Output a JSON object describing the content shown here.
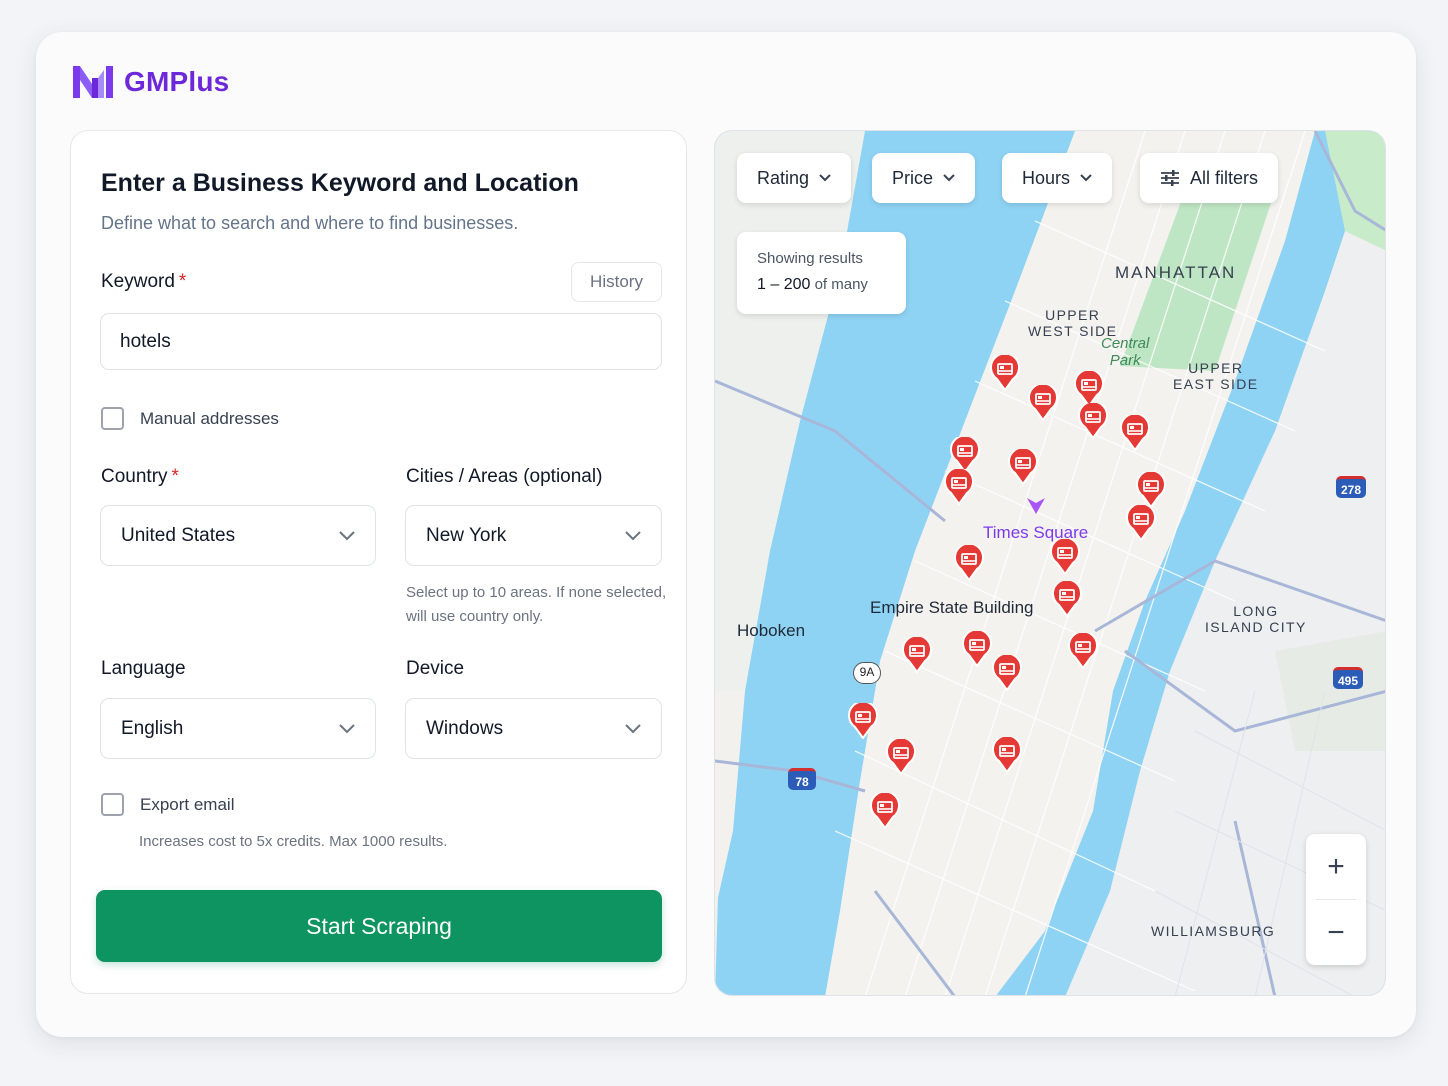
{
  "app": {
    "name": "GMPlus",
    "brand_color": "#6d28d9",
    "accent_color": "#0d9460"
  },
  "form": {
    "title": "Enter a Business Keyword and Location",
    "subtitle": "Define what to search and where to find businesses.",
    "keyword_label": "Keyword",
    "required_mark": "*",
    "history_label": "History",
    "keyword_value": "hotels",
    "manual_addresses_label": "Manual addresses",
    "manual_addresses_checked": false,
    "country_label": "Country",
    "country_value": "United States",
    "cities_label": "Cities / Areas (optional)",
    "cities_value": "New York",
    "cities_helper_line1": "Select up to 10 areas. If none selected,",
    "cities_helper_line2": "will use country only.",
    "language_label": "Language",
    "language_value": "English",
    "device_label": "Device",
    "device_value": "Windows",
    "export_email_label": "Export email",
    "export_email_checked": false,
    "export_email_helper": "Increases cost to 5x credits. Max 1000 results.",
    "start_button": "Start Scraping"
  },
  "map": {
    "filters": [
      "Rating",
      "Price",
      "Hours"
    ],
    "all_filters": "All filters",
    "results_line1": "Showing results",
    "results_range": "1 – 200",
    "results_suffix": "of many",
    "labels": {
      "manhattan": "MANHATTAN",
      "upper_west_1": "UPPER",
      "upper_west_2": "WEST SIDE",
      "central_1": "Central",
      "central_2": "Park",
      "upper_east_1": "UPPER",
      "upper_east_2": "EAST SIDE",
      "times_square": "Times Square",
      "empire": "Empire State Building",
      "hoboken": "Hoboken",
      "lic_1": "LONG",
      "lic_2": "ISLAND CITY",
      "williamsburg": "WILLIAMSBURG",
      "route_9a": "9A",
      "route_278": "278",
      "route_495": "495",
      "route_78": "78"
    },
    "zoom_in": "+",
    "zoom_out": "−",
    "marker_color": "#e53935",
    "water_color": "#8fd3f4",
    "park_color": "#bfe6c4",
    "icons": [
      "hotel-marker-icon",
      "chevron-down-icon",
      "sliders-icon",
      "place-marker-icon"
    ]
  }
}
